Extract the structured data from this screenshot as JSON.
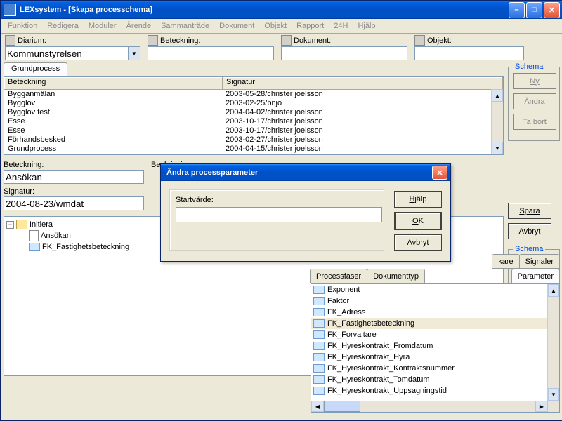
{
  "titlebar": {
    "text": "LEXsystem - [Skapa processchema]"
  },
  "menu": {
    "items": [
      "Funktion",
      "Redigera",
      "Moduler",
      "Ärende",
      "Sammanträde",
      "Dokument",
      "Objekt",
      "Rapport",
      "24H",
      "Hjälp"
    ]
  },
  "toolbar": {
    "diarium": {
      "label": "Diarium:",
      "value": "Kommunstyrelsen",
      "width": 186
    },
    "beteckning": {
      "label": "Beteckning:",
      "value": "",
      "width": 174
    },
    "dokument": {
      "label": "Dokument:",
      "value": "",
      "width": 174
    },
    "objekt": {
      "label": "Objekt:",
      "value": "",
      "width": 150
    }
  },
  "tabs": {
    "grundprocess": "Grundprocess"
  },
  "listview": {
    "cols": {
      "beteckning": "Beteckning",
      "signatur": "Signatur"
    },
    "rows": [
      {
        "b": "Bygganmälan",
        "s": "2003-05-28/christer joelsson"
      },
      {
        "b": "Bygglov",
        "s": "2003-02-25/bnjo"
      },
      {
        "b": "Bygglov test",
        "s": "2004-04-02/christer joelsson"
      },
      {
        "b": "Esse",
        "s": "2003-10-17/christer joelsson"
      },
      {
        "b": "Esse",
        "s": "2003-10-17/christer joelsson"
      },
      {
        "b": "Förhandsbesked",
        "s": "2003-02-27/christer joelsson"
      },
      {
        "b": "Grundprocess",
        "s": "2004-04-15/christer joelsson"
      }
    ]
  },
  "fields": {
    "beteckning": {
      "label": "Beteckning:",
      "value": "Ansökan"
    },
    "beskrivning": {
      "label": "Beskrivning:"
    },
    "signatur": {
      "label": "Signatur:",
      "value": "2004-08-23/wmdat"
    }
  },
  "tree": {
    "root": "Initiera",
    "children": [
      "Ansökan",
      "FK_Fastighetsbeteckning"
    ]
  },
  "right_tabs": {
    "row1": [
      "Processfaser",
      "Dokumenttyp",
      "kare",
      "Signaler"
    ],
    "row2": [
      "Parameter"
    ]
  },
  "params": [
    "Exponent",
    "Faktor",
    "FK_Adress",
    "FK_Fastighetsbeteckning",
    "FK_Forvaltare",
    "FK_Hyreskontrakt_Fromdatum",
    "FK_Hyreskontrakt_Hyra",
    "FK_Hyreskontrakt_Kontraktsnummer",
    "FK_Hyreskontrakt_Tomdatum",
    "FK_Hyreskontrakt_Uppsagningstid"
  ],
  "params_selected_index": 3,
  "schema_box": {
    "title": "Schema",
    "ny": "Ny",
    "andra": "Ändra",
    "tabort": "Ta bort",
    "spara": "Spara",
    "avbryt": "Avbryt",
    "title2": "Schema"
  },
  "dialog": {
    "title": "Ändra processparameter",
    "startvarde": "Startvärde:",
    "hjalp": "Hjälp",
    "ok": "OK",
    "avbryt": "Avbryt"
  }
}
